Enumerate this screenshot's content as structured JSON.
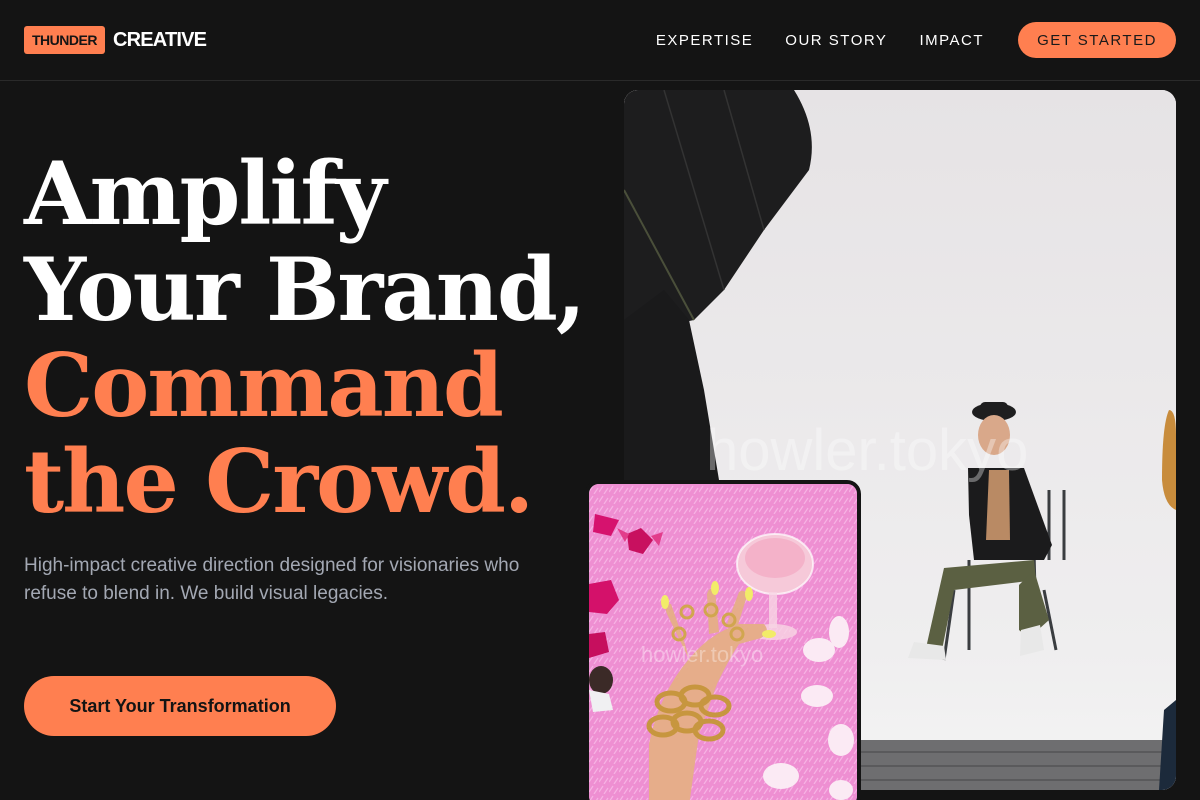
{
  "header": {
    "logo_badge": "THUNDER",
    "logo_word": "CREATIVE",
    "nav": [
      "EXPERTISE",
      "OUR STORY",
      "IMPACT"
    ],
    "cta_label": "GET STARTED"
  },
  "hero": {
    "headline_lines": [
      "Amplify",
      "Your Brand,",
      "Command",
      "the Crowd."
    ],
    "subtitle": "High-impact creative direction designed for visionaries who refuse to blend in. We build visual legacies.",
    "cta_label": "Start Your Transformation"
  },
  "images": {
    "main_watermark": "howler.tokyo",
    "small_watermark": "howler.tokyo"
  },
  "colors": {
    "background": "#141414",
    "accent": "#ff7f50",
    "muted_text": "#a3a8b3"
  }
}
